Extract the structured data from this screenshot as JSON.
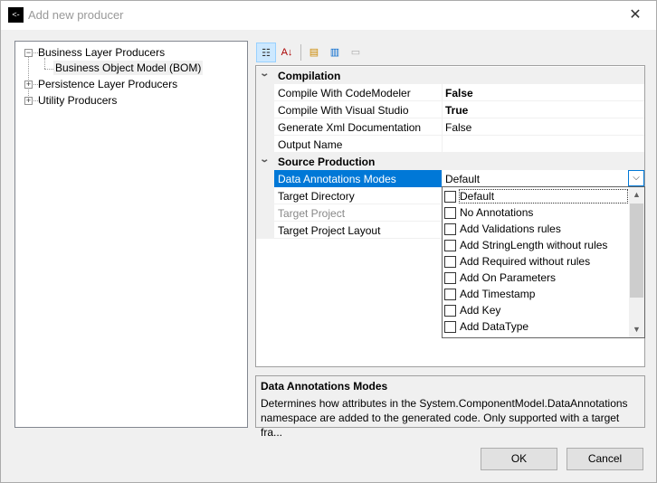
{
  "window": {
    "title": "Add new producer",
    "app_icon": "app-icon",
    "close_icon": "close-icon"
  },
  "tree": {
    "nodes": [
      {
        "label": "Business Layer Producers",
        "expanded": true,
        "children": [
          {
            "label": "Business Object Model (BOM)",
            "selected": true
          }
        ]
      },
      {
        "label": "Persistence Layer Producers",
        "expanded": false
      },
      {
        "label": "Utility Producers",
        "expanded": false
      }
    ]
  },
  "toolbar": {
    "buttons": [
      "categorized-icon",
      "alphabetical-icon",
      "add-property-icon",
      "property-pages-icon",
      "events-icon"
    ]
  },
  "grid": {
    "categories": [
      {
        "name": "Compilation",
        "rows": [
          {
            "name": "Compile With CodeModeler",
            "value": "False",
            "bold": true
          },
          {
            "name": "Compile With Visual Studio",
            "value": "True",
            "bold": true
          },
          {
            "name": "Generate Xml Documentation",
            "value": "False"
          },
          {
            "name": "Output Name",
            "value": ""
          }
        ]
      },
      {
        "name": "Source Production",
        "rows": [
          {
            "name": "Data Annotations Modes",
            "value": "Default",
            "selected": true
          },
          {
            "name": "Target Directory",
            "value": ""
          },
          {
            "name": "Target Project",
            "value": "",
            "disabled": true
          },
          {
            "name": "Target Project Layout",
            "value": ""
          }
        ]
      }
    ]
  },
  "dropdown": {
    "items": [
      "Default",
      "No Annotations",
      "Add Validations rules",
      "Add StringLength without rules",
      "Add Required without rules",
      "Add On Parameters",
      "Add Timestamp",
      "Add Key",
      "Add DataType"
    ],
    "checked": []
  },
  "description": {
    "title": "Data Annotations Modes",
    "text": "Determines how attributes in the System.ComponentModel.DataAnnotations namespace are added to the generated code. Only supported with a target fra..."
  },
  "buttons": {
    "ok": "OK",
    "cancel": "Cancel"
  },
  "colors": {
    "selection": "#0078d7"
  }
}
